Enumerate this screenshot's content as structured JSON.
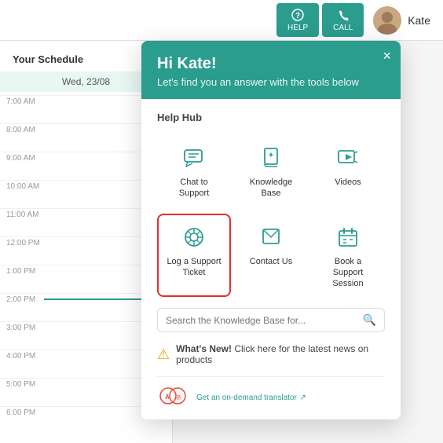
{
  "topNav": {
    "helpLabel": "HELP",
    "callLabel": "CALL",
    "userName": "Kate"
  },
  "sidebar": {
    "title": "Your Schedule",
    "date": "Wed, 23/08",
    "timeSlots": [
      {
        "label": "7:00 AM",
        "current": false
      },
      {
        "label": "8:00 AM",
        "current": false
      },
      {
        "label": "9:00 AM",
        "current": false
      },
      {
        "label": "10:00 AM",
        "current": false
      },
      {
        "label": "11:00 AM",
        "current": false
      },
      {
        "label": "12:00 PM",
        "current": false
      },
      {
        "label": "1:00 PM",
        "current": false
      },
      {
        "label": "2:00 PM",
        "current": true
      },
      {
        "label": "3:00 PM",
        "current": false
      },
      {
        "label": "4:00 PM",
        "current": false
      },
      {
        "label": "5:00 PM",
        "current": false
      },
      {
        "label": "6:00 PM",
        "current": false
      }
    ]
  },
  "popup": {
    "greeting": "Hi Kate!",
    "subtitle": "Let's find you an answer with the tools below",
    "closeLabel": "×",
    "helpHubLabel": "Help Hub",
    "items": [
      {
        "id": "chat",
        "label": "Chat to\nSupport",
        "highlighted": false
      },
      {
        "id": "knowledge",
        "label": "Knowledge\nBase",
        "highlighted": false
      },
      {
        "id": "videos",
        "label": "Videos",
        "highlighted": false
      },
      {
        "id": "ticket",
        "label": "Log a Support\nTicket",
        "highlighted": true
      },
      {
        "id": "contact",
        "label": "Contact Us",
        "highlighted": false
      },
      {
        "id": "book",
        "label": "Book a\nSupport\nSession",
        "highlighted": false
      }
    ],
    "searchPlaceholder": "Search the Knowledge Base for...",
    "whatsNew": {
      "prefix": "What's New!",
      "text": "  Click here for the latest news on products"
    },
    "translatorText": "Get an on-demand translator"
  }
}
